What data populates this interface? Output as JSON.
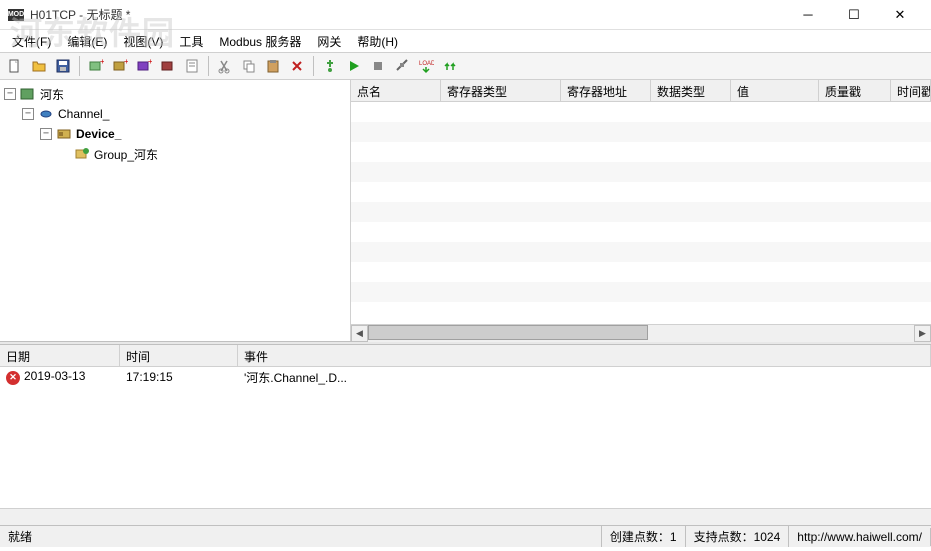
{
  "window": {
    "app_icon_text": "MOD",
    "title": "H01TCP - 无标题 *"
  },
  "watermark": "河东软件园",
  "menu": {
    "file": "文件(F)",
    "edit": "编辑(E)",
    "view": "视图(V)",
    "tools": "工具",
    "modbus_server": "Modbus 服务器",
    "gateway": "网关",
    "help": "帮助(H)"
  },
  "tree": {
    "root": "河东",
    "channel": "Channel_",
    "device": "Device_",
    "group": "Group_河东"
  },
  "grid_columns": {
    "name": "点名",
    "reg_type": "寄存器类型",
    "reg_addr": "寄存器地址",
    "data_type": "数据类型",
    "value": "值",
    "quality": "质量戳",
    "timestamp": "时间戳"
  },
  "log_columns": {
    "date": "日期",
    "time": "时间",
    "event": "事件"
  },
  "log_rows": [
    {
      "date": "2019-03-13",
      "time": "17:19:15",
      "event": "'河东.Channel_.D..."
    }
  ],
  "statusbar": {
    "ready": "就绪",
    "created_points": "创建点数：1",
    "supported_points": "支持点数：1024",
    "url": "http://www.haiwell.com/"
  }
}
